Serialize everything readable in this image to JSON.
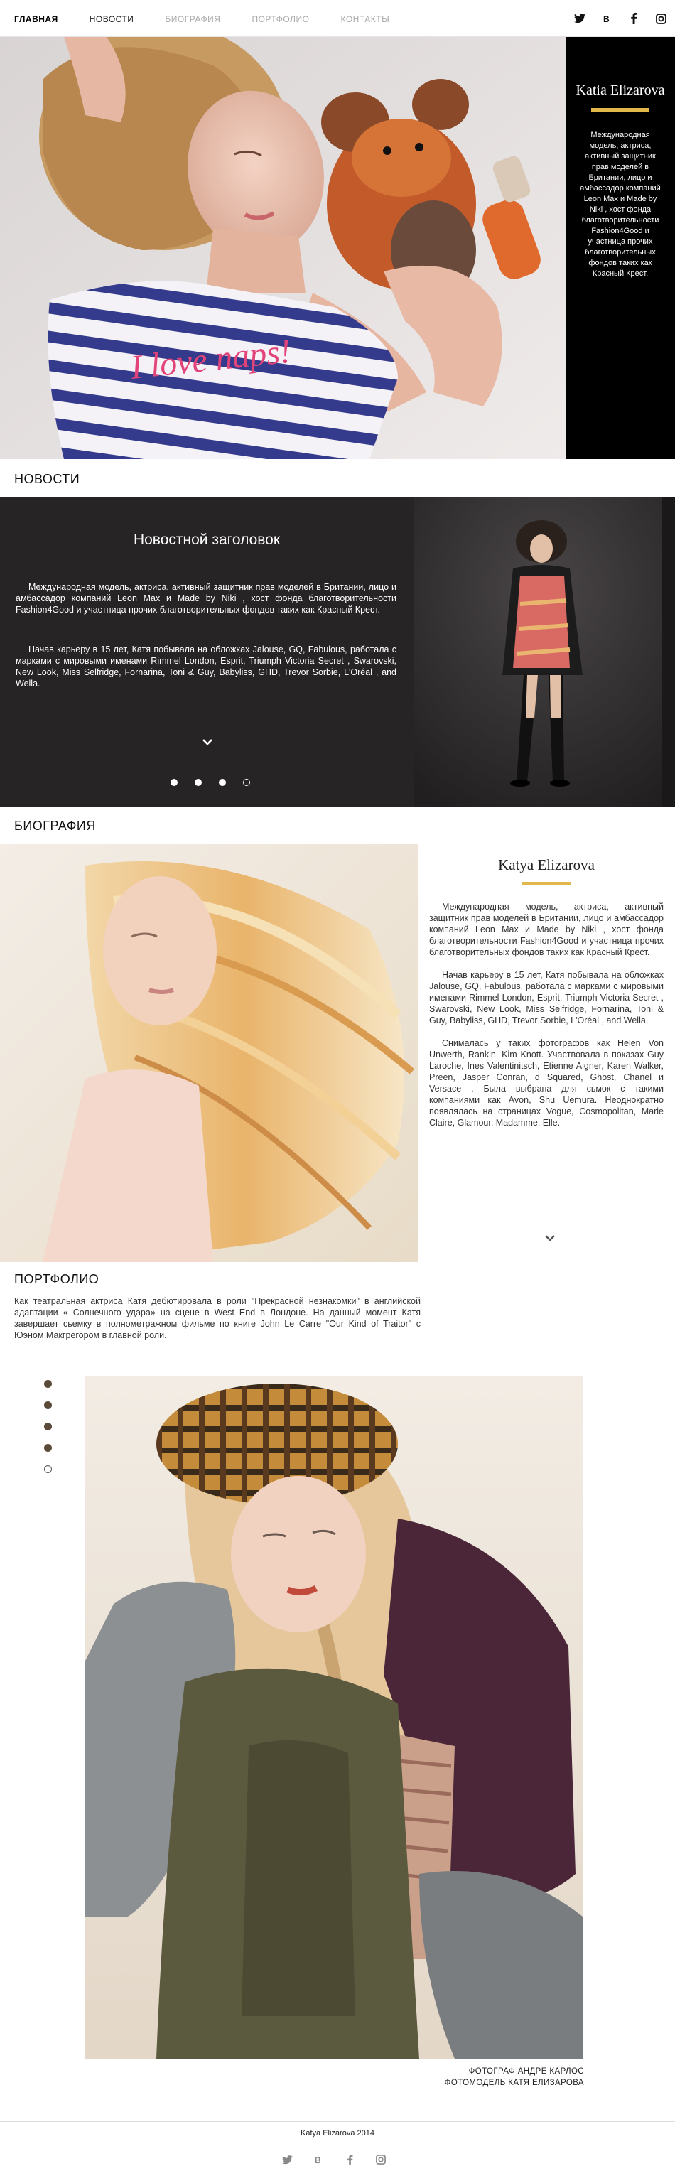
{
  "nav": {
    "items": [
      {
        "label": "ГЛАВНАЯ",
        "state": "active"
      },
      {
        "label": "НОВОСТИ",
        "state": "normal"
      },
      {
        "label": "БИОГРАФИЯ",
        "state": "muted"
      },
      {
        "label": "ПОРТФОЛИО",
        "state": "muted"
      },
      {
        "label": "КОНТАКТЫ",
        "state": "muted"
      }
    ],
    "social": [
      "twitter-icon",
      "vk-icon",
      "facebook-icon",
      "instagram-icon"
    ]
  },
  "hero": {
    "name": "Katia Elizarova",
    "description": "Международная модель, актриса, активный защитник прав моделей в Британии, лицо и амбассадор компаний Leon Max и Made by Niki , хост фонда благотворительности Fashion4Good и участница прочих благотворительных фондов таких как Красный Крест.",
    "shirt_text": "I love naps!",
    "accent_color": "#e2b84a"
  },
  "news": {
    "section_title": "НОВОСТИ",
    "headline": "Новостной заголовок",
    "paragraph1": "Международная модель, актриса, активный защитник прав моделей в Британии, лицо и амбассадор компаний Leon Max и  Made by Niki , хост фонда благотворительности Fashion4Good и участница прочих благотворительных фондов таких как Красный Крест.",
    "paragraph2": "Начав карьеру в 15 лет, Катя побывала на обложках Jalouse, GQ, Fabulous, работала с марками с мировыми именами Rimmel London, Esprit, Triumph Victoria Secret , Swarovski, New Look, Miss Selfridge, Fornarina, Toni & Guy, Babyliss, GHD, Trevor Sorbie, L'Oréal , and Wella.",
    "slider_dots": 4,
    "active_dot": 2
  },
  "bio": {
    "section_title": "БИОГРАФИЯ",
    "name": "Katya Elizarova",
    "paragraph1": "Международная модель, актриса, активный защитник прав моделей в Британии, лицо и амбассадор компаний Leon Max и  Made by Niki , хост фонда благотворительности Fashion4Good и участница прочих благотворительных фондов таких как Красный Крест.",
    "paragraph2": "Начав карьеру в 15 лет, Катя побывала на обложках Jalouse, GQ, Fabulous, работала с марками с мировыми именами Rimmel London, Esprit, Triumph Victoria Secret , Swarovski, New Look, Miss Selfridge, Fornarina, Toni & Guy, Babyliss, GHD, Trevor Sorbie, L'Oréal , and Wella.",
    "paragraph3": "Снималась у таких фотографов как Helen Von Unwerth, Rankin, Kim Knott. Участвовала в показах Guy Laroche, Ines Valentinitsch, Etienne Aigner, Karen Walker, Preen, Jasper Conran, d Squared, Ghost, Chanel и Versace . Была выбрана для сьмок с такими компаниями как Avon, Shu Uemura. Неоднократно появлялась на страницах Vogue, Cosmopolitan, Marie Claire, Glamour, Madamme, Elle."
  },
  "portfolio": {
    "section_title": "ПОРТФОЛИО",
    "text": "Как театральная актриса Катя дебютировала в роли \"Прекрасной незнакомки\" в английской адаптации « Солнечного удара» на сцене в West End в Лондоне. На данный момент Катя завершает сьемку в полнометражном фильме по книге John Le Carre \"Our Kind of Traitor\" с Юэном Макгрегором в главной роли.",
    "slider_dots": 5,
    "active_dot": 4,
    "credit_line1": "ФОТОГРАФ АНДРЕ КАРЛОС",
    "credit_line2": "ФОТОМОДЕЛЬ КАТЯ ЕЛИЗАРОВА"
  },
  "footer": {
    "copyright": "Katya  Elizarova  2014",
    "social": [
      "twitter-icon",
      "vk-icon",
      "facebook-icon",
      "instagram-icon"
    ]
  }
}
